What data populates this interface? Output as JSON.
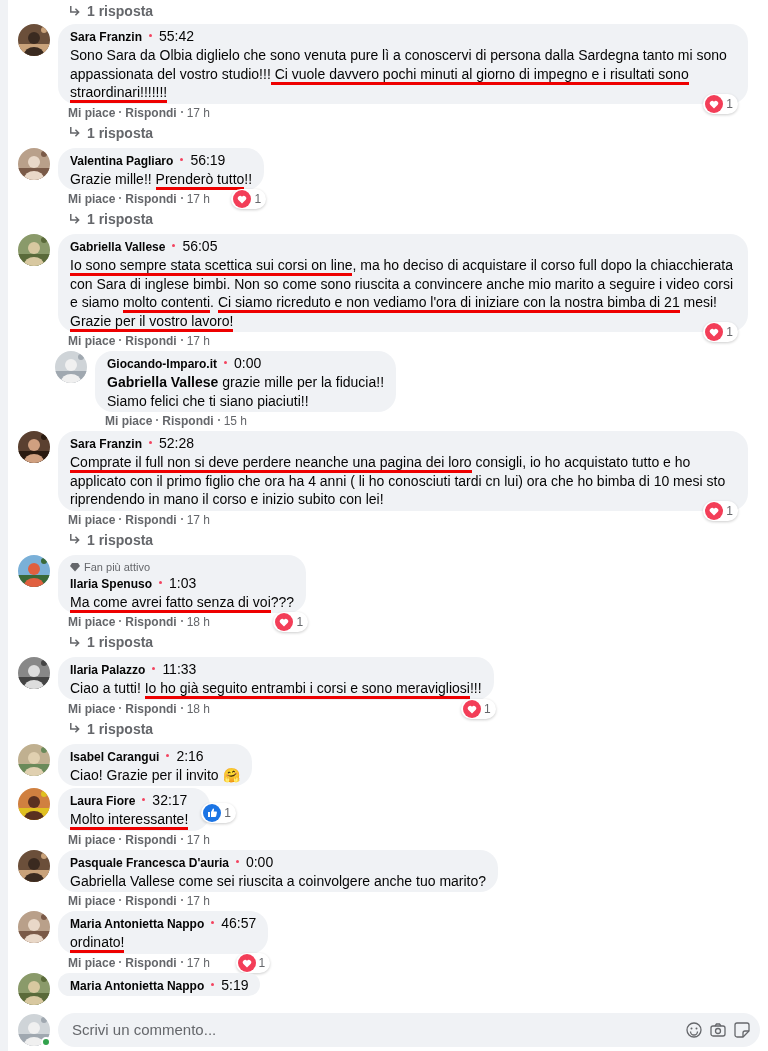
{
  "top_replies_link": "1 risposta",
  "comments": [
    {
      "author": "Sara Franzin",
      "time": "55:42",
      "text": [
        {
          "text": "Sono Sara da Olbia diglielo che sono venuta pure lì a conoscervi di persona dalla Sardegna tanto mi sono appassionata del vostro studio!!!",
          "marked": false
        },
        {
          "text": " Ci vuole davvero pochi minuti al giorno di impegno e i risultati sono straordinari!!!!!!!",
          "marked": true
        }
      ],
      "reaction": {
        "kind": "love",
        "count": "1"
      },
      "actions": [
        "Mi piace",
        "Rispondi",
        "17 h"
      ],
      "replies_link": "1 risposta"
    },
    {
      "author": "Valentina Pagliaro",
      "time": "56:19",
      "text": [
        {
          "text": "Grazie mille!! ",
          "marked": false
        },
        {
          "text": "Prenderò tutto",
          "marked": true
        },
        {
          "text": "!!",
          "marked": false
        }
      ],
      "reaction": {
        "kind": "love",
        "count": "1"
      },
      "actions": [
        "Mi piace",
        "Rispondi",
        "17 h"
      ],
      "replies_link": "1 risposta"
    },
    {
      "author": "Gabriella Vallese",
      "time": "56:05",
      "text": [
        {
          "text": "Io sono sempre stata scettica sui corsi on line",
          "marked": true
        },
        {
          "text": ", ma ho deciso di acquistare il corso full dopo la chiacchierata con Sara di inglese bimbi. Non so come sono riuscita a convincere anche mio marito a seguire i video corsi e siamo ",
          "marked": false
        },
        {
          "text": "molto contenti",
          "marked": true
        },
        {
          "text": ". ",
          "marked": false
        },
        {
          "text": "Ci siamo ricreduto e non vediamo l'ora di iniziare con la nostra bimba di 21",
          "marked": true
        },
        {
          "text": " mesi! ",
          "marked": false
        },
        {
          "text": "Grazie per il vostro lavoro!",
          "marked": true
        }
      ],
      "reaction": {
        "kind": "love",
        "count": "1"
      },
      "actions": [
        "Mi piace",
        "Rispondi",
        "17 h"
      ],
      "replies": [
        {
          "author": "Giocando-Imparo.it",
          "time": "0:00",
          "text": [
            {
              "text": "**Gabriella Vallese** grazie mille per la fiducia!!\nSiamo felici che ti siano piaciuti!!",
              "marked": false
            }
          ],
          "actions": [
            "Mi piace",
            "Rispondi",
            "15 h"
          ]
        }
      ]
    },
    {
      "author": "Sara Franzin",
      "time": "52:28",
      "text": [
        {
          "text": "Comprate il full non si deve perdere neanche una pagina dei loro",
          "marked": true
        },
        {
          "text": " consigli, io ho acquistato tutto e ho applicato con il primo figlio che ora ha 4 anni ( li ho conosciuti tardi cn lui) ora che ho bimba di 10 mesi sto riprendendo in mano il corso e inizio subito con lei!",
          "marked": false
        }
      ],
      "reaction": {
        "kind": "love",
        "count": "1"
      },
      "actions": [
        "Mi piace",
        "Rispondi",
        "17 h"
      ],
      "replies_link": "1 risposta"
    },
    {
      "author": "Ilaria Spenuso",
      "time": "1:03",
      "badge": "Fan più attivo",
      "text": [
        {
          "text": "Ma come avrei fatto senza di voi",
          "marked": true
        },
        {
          "text": "???",
          "marked": false
        }
      ],
      "reaction": {
        "kind": "love",
        "count": "1"
      },
      "actions": [
        "Mi piace",
        "Rispondi",
        "18 h"
      ],
      "replies_link": "1 risposta"
    },
    {
      "author": "Ilaria Palazzo",
      "time": "11:33",
      "text": [
        {
          "text": "Ciao a tutti! ",
          "marked": false
        },
        {
          "text": "Io ho già seguito entrambi i corsi e sono meravigliosi",
          "marked": true
        },
        {
          "text": "!!!",
          "marked": false
        }
      ],
      "reaction": {
        "kind": "love",
        "count": "1"
      },
      "actions": [
        "Mi piace",
        "Rispondi",
        "18 h"
      ],
      "replies_link": "1 risposta"
    },
    {
      "author": "Isabel Carangui",
      "time": "2:16",
      "text": [
        {
          "text": "Ciao! Grazie per il invito 🤗",
          "marked": false
        }
      ]
    },
    {
      "author": "Laura Fiore",
      "time": "32:17",
      "text": [
        {
          "text": "Molto interessante!",
          "marked": true
        }
      ],
      "reaction": {
        "kind": "like",
        "count": "1"
      },
      "actions": [
        "Mi piace",
        "Rispondi",
        "17 h"
      ]
    },
    {
      "author": "Pasquale Francesca D'auria",
      "time": "0:00",
      "text": [
        {
          "text": "Gabriella Vallese come sei riuscita a coinvolgere anche tuo marito?",
          "marked": false
        }
      ],
      "actions": [
        "Mi piace",
        "Rispondi",
        "17 h"
      ]
    },
    {
      "author": "Maria Antonietta Nappo",
      "time": "46:57",
      "text": [
        {
          "text": "ordinato!",
          "marked": true
        }
      ],
      "reaction": {
        "kind": "love",
        "count": "1"
      },
      "actions": [
        "Mi piace",
        "Rispondi",
        "17 h"
      ]
    },
    {
      "author": "Maria Antonietta Nappo",
      "time": "5:19"
    }
  ],
  "composer": {
    "placeholder": "Scrivi un commento..."
  }
}
